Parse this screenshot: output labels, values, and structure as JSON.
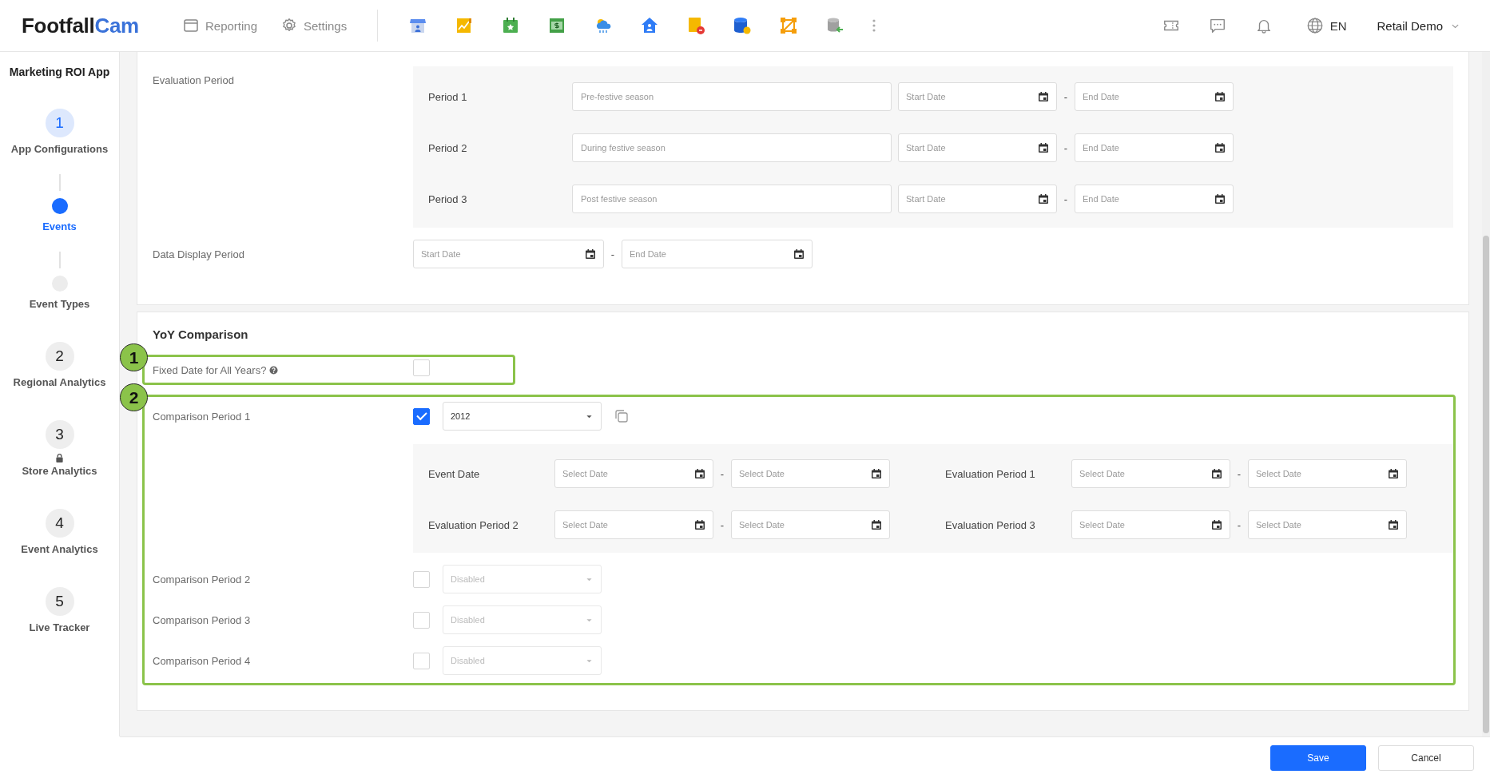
{
  "header": {
    "logo": {
      "text": "Footfall",
      "accent": "Cam"
    },
    "nav": [
      {
        "label": "Reporting",
        "kind": "reporting"
      },
      {
        "label": "Settings",
        "kind": "settings"
      }
    ],
    "language": "EN",
    "account": "Retail Demo"
  },
  "sidebar": {
    "title": "Marketing ROI App",
    "steps": [
      {
        "kind": "number",
        "number": "1",
        "label": "App Configurations",
        "selected": true
      },
      {
        "kind": "sub",
        "label": "Events",
        "selected": true
      },
      {
        "kind": "sub",
        "label": "Event Types",
        "selected": false
      },
      {
        "kind": "number",
        "number": "2",
        "label": "Regional Analytics",
        "selected": false
      },
      {
        "kind": "number",
        "number": "3",
        "label": "Store Analytics",
        "selected": false,
        "locked": true
      },
      {
        "kind": "number",
        "number": "4",
        "label": "Event Analytics",
        "selected": false
      },
      {
        "kind": "number",
        "number": "5",
        "label": "Live Tracker",
        "selected": false
      }
    ]
  },
  "events_card": {
    "evaluation_period": {
      "label": "Evaluation Period",
      "periods": [
        {
          "label": "Period 1",
          "name_placeholder": "Pre-festive season",
          "start_placeholder": "Start Date",
          "separator": "-",
          "end_placeholder": "End Date"
        },
        {
          "label": "Period 2",
          "name_placeholder": "During festive season",
          "start_placeholder": "Start Date",
          "separator": "-",
          "end_placeholder": "End Date"
        },
        {
          "label": "Period 3",
          "name_placeholder": "Post festive season",
          "start_placeholder": "Start Date",
          "separator": "-",
          "end_placeholder": "End Date"
        }
      ]
    },
    "data_display_period": {
      "label": "Data Display Period",
      "start_placeholder": "Start Date",
      "separator": "-",
      "end_placeholder": "End Date"
    }
  },
  "yoy": {
    "title": "YoY Comparison",
    "fixed_date": {
      "annotation": "1",
      "label": "Fixed Date for All Years?",
      "checked": false
    },
    "comparison_annotation": "2",
    "comparison_periods": [
      {
        "label": "Comparison Period 1",
        "checked": true,
        "disabled": false,
        "value": "2012",
        "details": [
          {
            "label": "Event Date",
            "start_placeholder": "Select Date",
            "separator": "-",
            "end_placeholder": "Select Date"
          },
          {
            "label": "Evaluation Period 1",
            "start_placeholder": "Select Date",
            "separator": "-",
            "end_placeholder": "Select Date"
          },
          {
            "label": "Evaluation Period 2",
            "start_placeholder": "Select Date",
            "separator": "-",
            "end_placeholder": "Select Date"
          },
          {
            "label": "Evaluation Period 3",
            "start_placeholder": "Select Date",
            "separator": "-",
            "end_placeholder": "Select Date"
          }
        ]
      },
      {
        "label": "Comparison Period 2",
        "checked": false,
        "disabled": true,
        "value": "Disabled"
      },
      {
        "label": "Comparison Period 3",
        "checked": false,
        "disabled": true,
        "value": "Disabled"
      },
      {
        "label": "Comparison Period 4",
        "checked": false,
        "disabled": true,
        "value": "Disabled"
      }
    ]
  },
  "footer": {
    "buttons": [
      {
        "label": "Save",
        "kind": "primary"
      },
      {
        "label": "Cancel",
        "kind": "secondary"
      }
    ]
  }
}
